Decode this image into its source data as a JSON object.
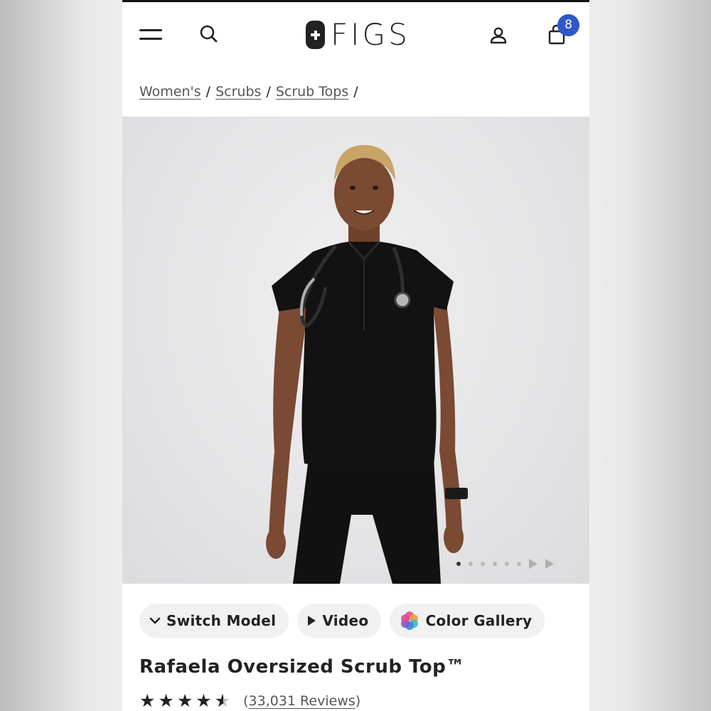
{
  "header": {
    "brand": "FIGS",
    "cart_count": "8",
    "icons": [
      "menu-icon",
      "search-icon",
      "account-icon",
      "shopping-bag-icon"
    ],
    "badge_color": "#2e58c9"
  },
  "breadcrumb": {
    "items": [
      "Women's",
      "Scrubs",
      "Scrub Tops"
    ],
    "separator": "/"
  },
  "gallery": {
    "image_alt": "Model wearing black oversized scrub top with stethoscope",
    "slide_count": 6,
    "active_slide": 1,
    "video_slides": 2
  },
  "actions": {
    "switch_model": "Switch Model",
    "video": "Video",
    "color_gallery": "Color Gallery"
  },
  "product": {
    "title": "Rafaela Oversized Scrub Top™",
    "rating": 4.5,
    "reviews_open": "(",
    "reviews_label": "33,031 Reviews",
    "reviews_close": ")"
  }
}
